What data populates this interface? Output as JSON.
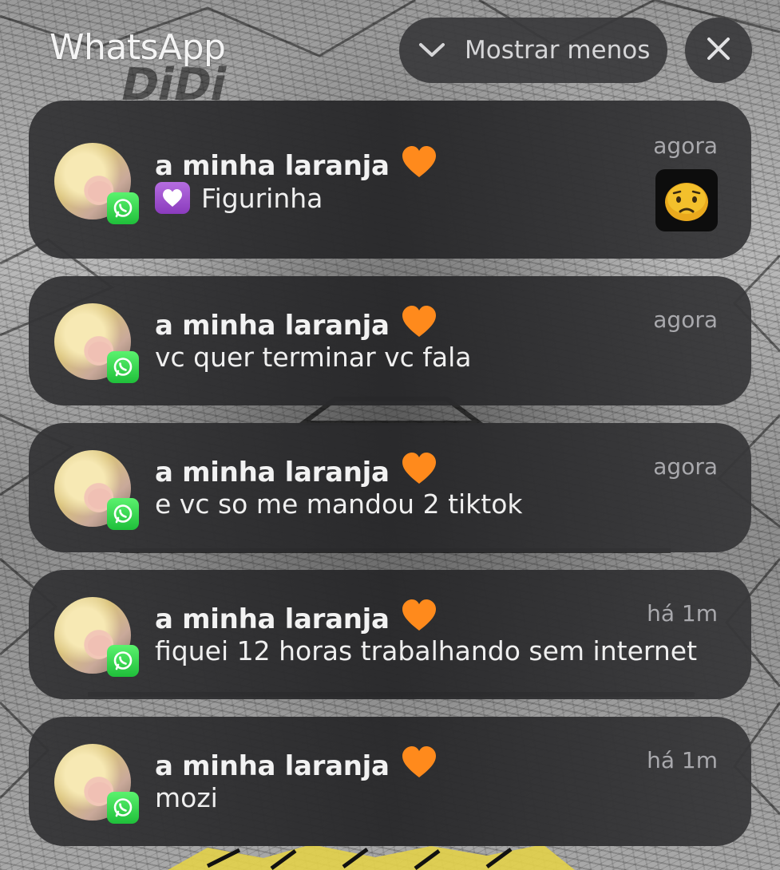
{
  "app": {
    "title": "WhatsApp"
  },
  "controls": {
    "show_less_label": "Mostrar menos",
    "show_less_icon": "chevron-down-icon",
    "close_icon": "close-icon"
  },
  "notifications": [
    {
      "sender": "a minha laranja",
      "sender_emoji": "orange-heart",
      "message": "Figurinha",
      "message_icon": "white-heart-sticker-icon",
      "time": "agora",
      "has_sticker": true,
      "sticker": "worried-face-sticker"
    },
    {
      "sender": "a minha laranja",
      "sender_emoji": "orange-heart",
      "message": "vc quer terminar vc fala",
      "time": "agora"
    },
    {
      "sender": "a minha laranja",
      "sender_emoji": "orange-heart",
      "message": "e vc so me mandou 2 tiktok",
      "time": "agora"
    },
    {
      "sender": "a minha laranja",
      "sender_emoji": "orange-heart",
      "message": "fiquei 12 horas trabalhando sem internet",
      "time": "há 1m"
    },
    {
      "sender": "a minha laranja",
      "sender_emoji": "orange-heart",
      "message": "mozi",
      "time": "há 1m"
    }
  ],
  "colors": {
    "card_bg": "#2e2e30",
    "whatsapp_green": "#25D366",
    "orange_heart": "#ff8a1c",
    "time_text": "#a9a9ad"
  }
}
